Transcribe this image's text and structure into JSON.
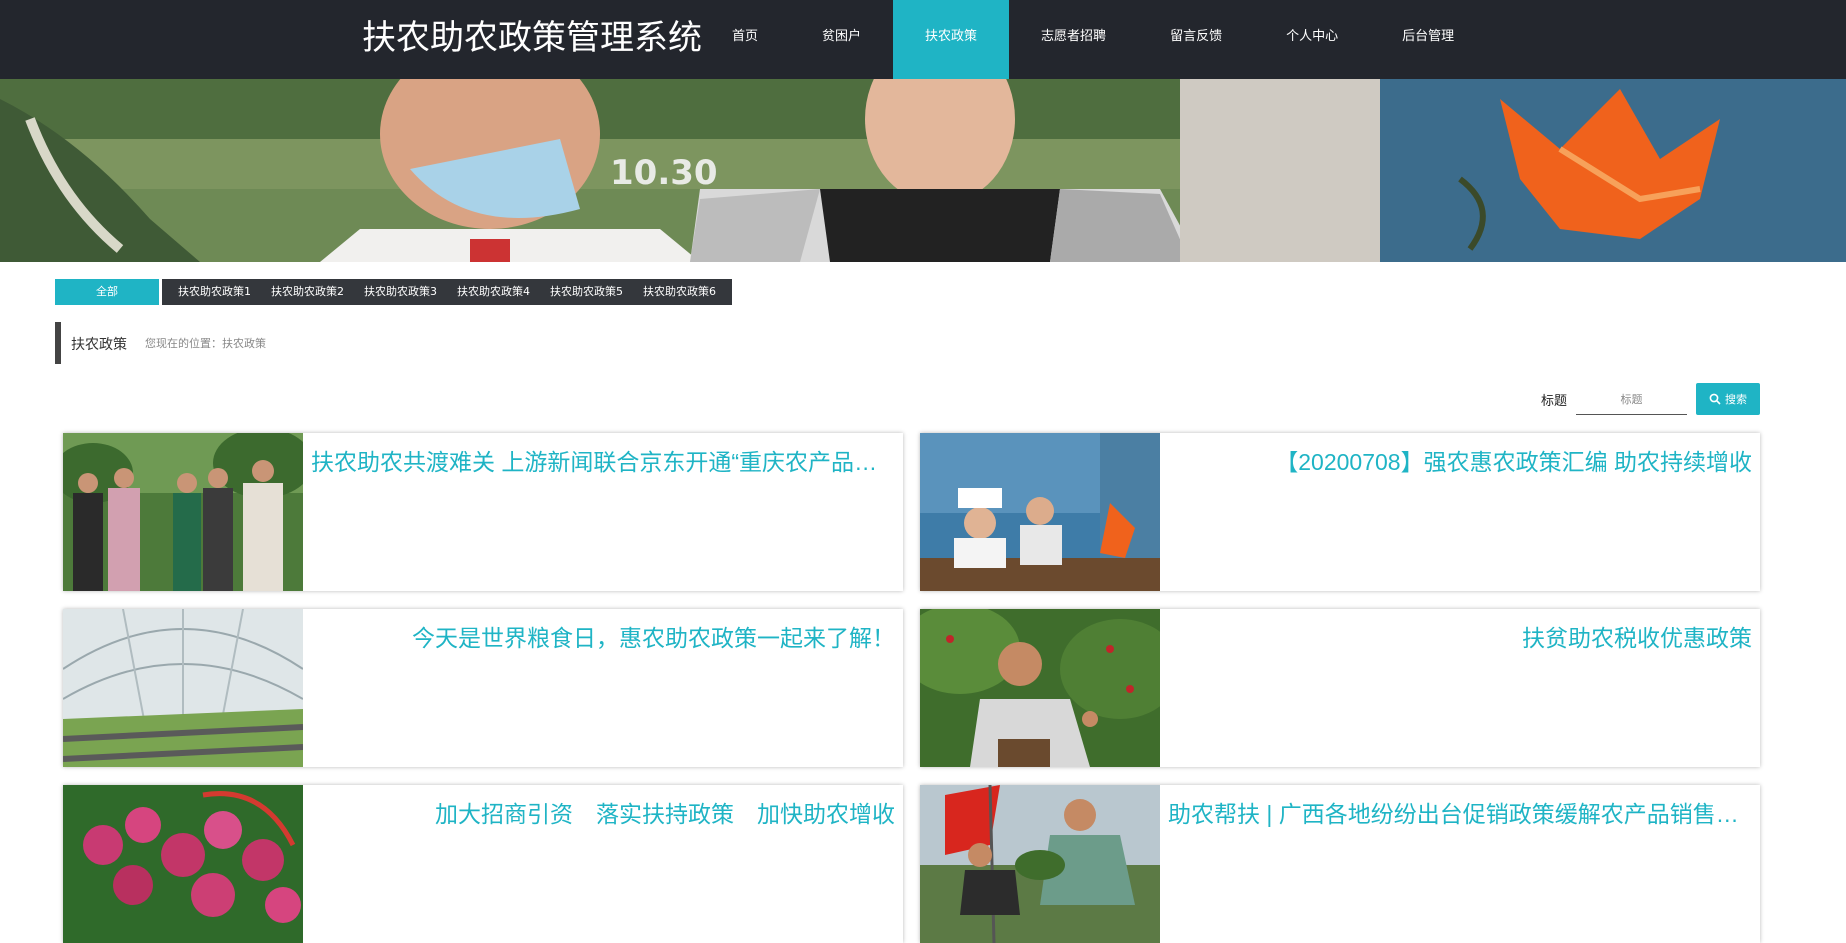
{
  "header": {
    "site_title": "扶农助农政策管理系统",
    "nav": [
      {
        "label": "首页",
        "active": false
      },
      {
        "label": "贫困户",
        "active": false
      },
      {
        "label": "扶农政策",
        "active": true
      },
      {
        "label": "志愿者招聘",
        "active": false
      },
      {
        "label": "留言反馈",
        "active": false
      },
      {
        "label": "个人中心",
        "active": false
      },
      {
        "label": "后台管理",
        "active": false
      }
    ]
  },
  "categories": {
    "all_label": "全部",
    "items": [
      "扶农助农政策1",
      "扶农助农政策2",
      "扶农助农政策3",
      "扶农助农政策4",
      "扶农助农政策5",
      "扶农助农政策6"
    ]
  },
  "breadcrumb": {
    "title": "扶农政策",
    "location": "您现在的位置：扶农政策"
  },
  "search": {
    "label": "标题",
    "placeholder": "标题",
    "button_label": "搜索"
  },
  "articles": [
    {
      "title": "扶农助农共渡难关 上游新闻联合京东开通“重庆农产品扶贫馆”"
    },
    {
      "title": "【20200708】强农惠农政策汇编 助农持续增收"
    },
    {
      "title": "今天是世界粮食日，惠农助农政策一起来了解！"
    },
    {
      "title": "扶贫助农税收优惠政策"
    },
    {
      "title": "加大招商引资　落实扶持政策　加快助农增收"
    },
    {
      "title": "助农帮扶 | 广西各地纷纷出台促销政策缓解农产品销售难题"
    }
  ],
  "colors": {
    "accent": "#1fb4c5",
    "header_bg": "#23262d",
    "category_bg": "#34373c"
  }
}
